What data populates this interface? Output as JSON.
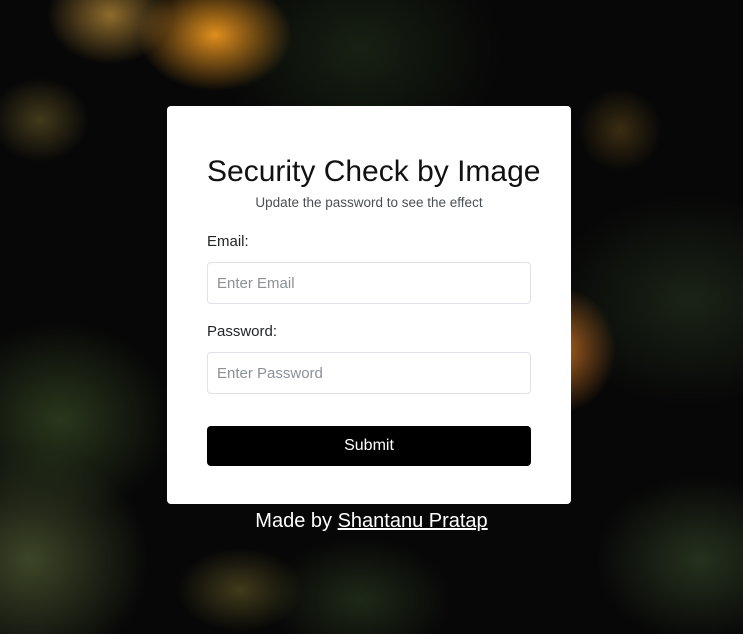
{
  "form": {
    "title": "Security Check by Image",
    "subtitle": "Update the password to see the effect",
    "email_label": "Email:",
    "email_placeholder": "Enter Email",
    "email_value": "",
    "password_label": "Password:",
    "password_placeholder": "Enter Password",
    "password_value": "",
    "submit_label": "Submit"
  },
  "footer": {
    "prefix": "Made by ",
    "author_link": "Shantanu Pratap"
  }
}
